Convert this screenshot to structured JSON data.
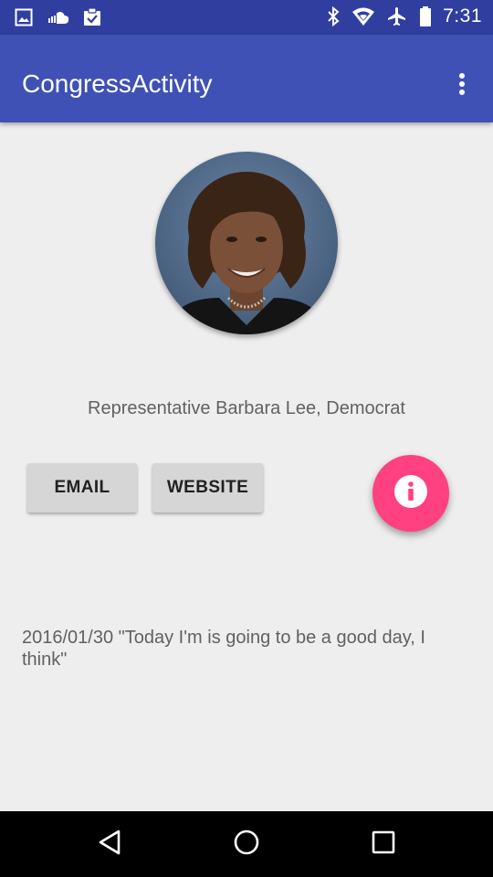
{
  "status_bar": {
    "time": "7:31",
    "left_icons": [
      "image-icon",
      "cloud-icon",
      "clipboard-check-icon"
    ],
    "right_icons": [
      "bluetooth-icon",
      "wifi-icon",
      "airplane-icon",
      "battery-icon"
    ]
  },
  "app_bar": {
    "title": "CongressActivity",
    "overflow_icon": "more-vert-icon"
  },
  "representative": {
    "name_line": "Representative Barbara Lee, Democrat",
    "avatar_icon": "representative-photo"
  },
  "actions": {
    "email_label": "EMAIL",
    "website_label": "WEBSITE",
    "info_icon": "info-icon",
    "fab_color": "#ff4081"
  },
  "tweet": {
    "text": "2016/01/30 \"Today I'm is going to be a good day, I think\""
  },
  "nav_bar": {
    "icons": [
      "back-icon",
      "home-icon",
      "recents-icon"
    ]
  },
  "colors": {
    "primary": "#3f51b5",
    "primary_dark": "#303f9f",
    "accent": "#ff4081",
    "background": "#eeeeee"
  }
}
